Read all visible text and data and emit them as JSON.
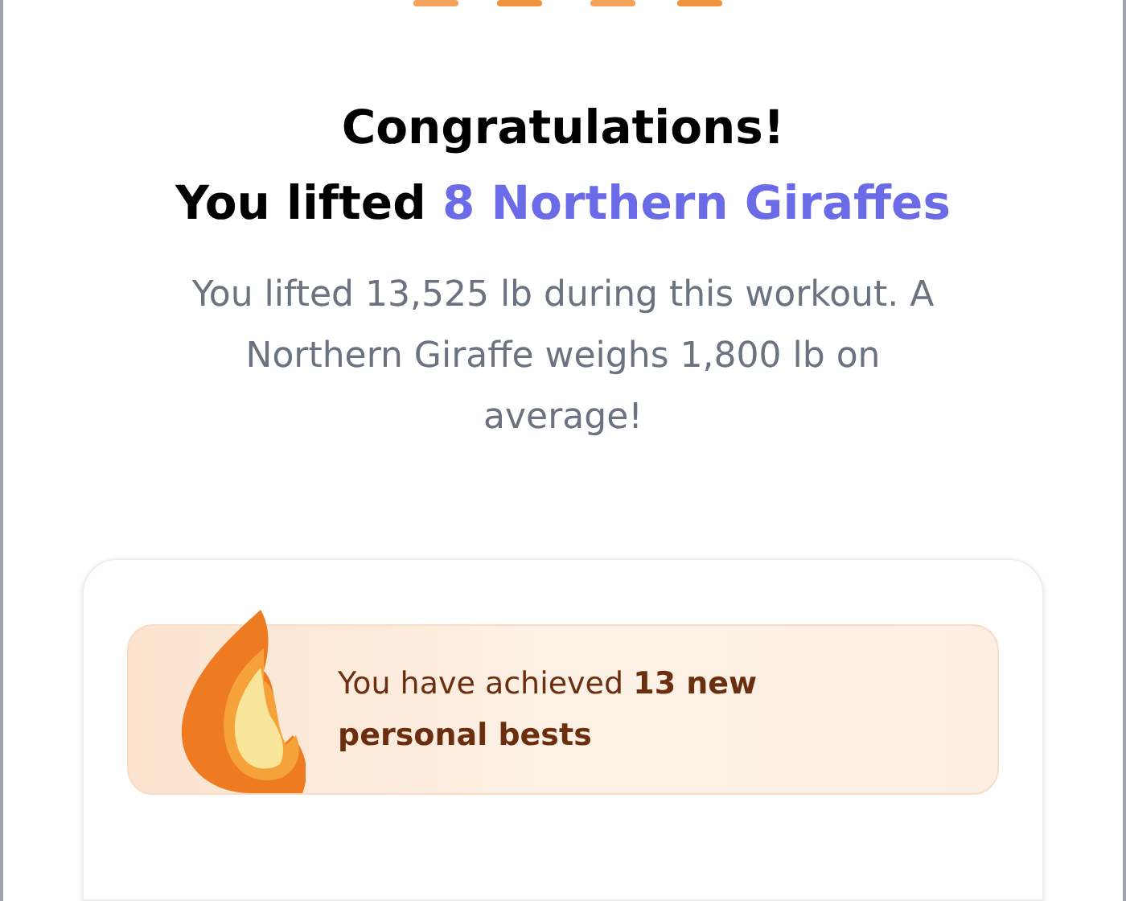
{
  "title": "Congratulations!",
  "headline": {
    "prefix": "You lifted",
    "highlight": "8 Northern Giraffes"
  },
  "description": "You lifted 13,525 lb during this workout. A Northern Giraffe weighs 1,800 lb on average!",
  "achievement": {
    "text": "You have achieved **13 new personal bests**"
  }
}
